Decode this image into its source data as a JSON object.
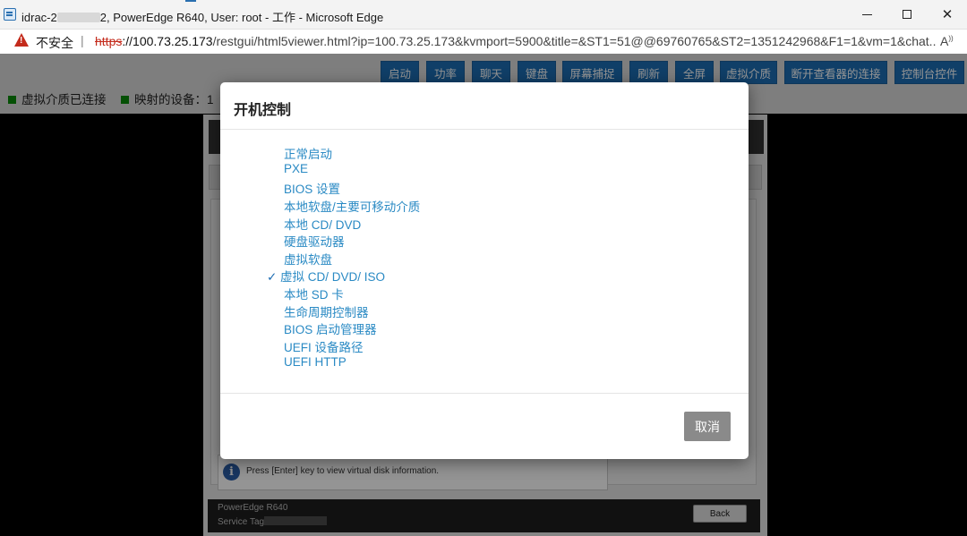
{
  "browser": {
    "title_prefix": "idrac-2",
    "title_suffix": "2, PowerEdge R640, User: root - 工作 - Microsoft Edge",
    "insecure_label": "不安全",
    "url_proto": "https",
    "url_host": "://100.73.25.173",
    "url_rest": "/restgui/html5viewer.html?ip=100.73.25.173&kvmport=5900&title=&ST1=51@@69760765&ST2=1351242968&F1=1&vm=1&chat..."
  },
  "toolbar": {
    "buttons": [
      "启动",
      "功率",
      "聊天",
      "键盘",
      "屏幕捕捉",
      "刷新",
      "全屏",
      "虚拟介质",
      "断开查看器的连接",
      "控制台控件"
    ],
    "status_connected": "虚拟介质已连接",
    "status_mapped": "映射的设备：1"
  },
  "bios": {
    "info_text": "Press [Enter] key to view virtual disk information.",
    "model": "PowerEdge R640",
    "service_tag_label": "Service Tag",
    "back_label": "Back"
  },
  "modal": {
    "title": "开机控制",
    "options": [
      "正常启动",
      "PXE",
      "BIOS 设置",
      "本地软盘/主要可移动介质",
      "本地 CD/ DVD",
      "硬盘驱动器",
      "虚拟软盘",
      "虚拟 CD/ DVD/ ISO",
      "本地 SD 卡",
      "生命周期控制器",
      "BIOS 启动管理器",
      "UEFI 设备路径",
      "UEFI HTTP"
    ],
    "selected_index": 7,
    "checkmark": "✓",
    "cancel_label": "取消"
  },
  "colors": {
    "toolbar_button": "#1d6db3",
    "option_link": "#2a8ac4",
    "status_green": "#0a8a0a",
    "cancel_button": "#8a8a8a"
  }
}
